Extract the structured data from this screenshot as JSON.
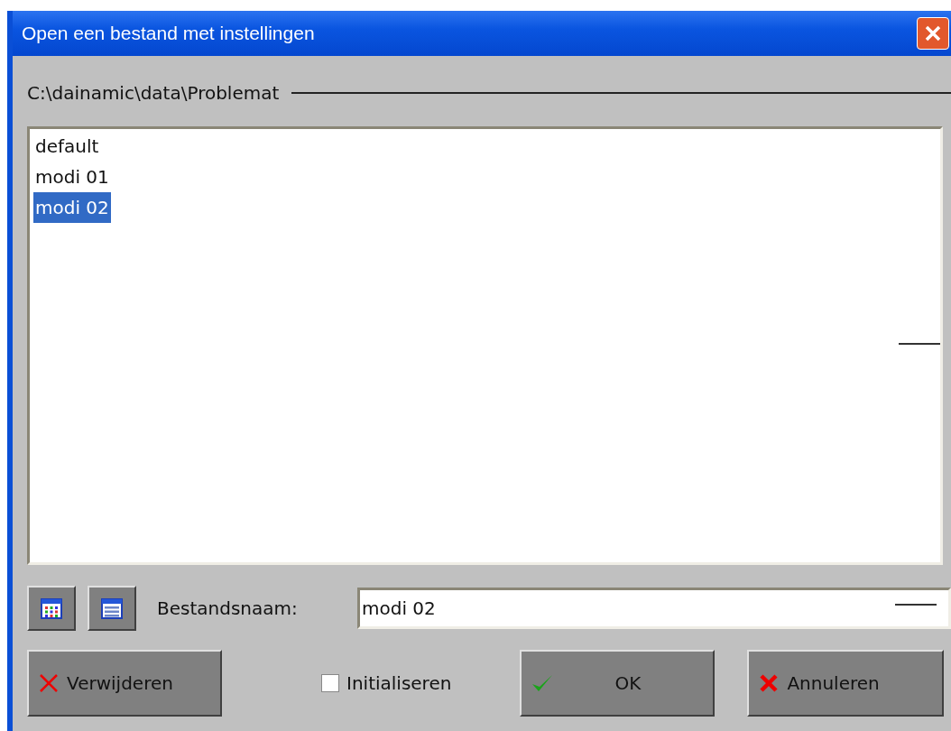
{
  "window": {
    "title": "Open een bestand met instellingen"
  },
  "path": "C:\\dainamic\\data\\Problemat",
  "files": [
    {
      "name": "default",
      "selected": false
    },
    {
      "name": "modi 01",
      "selected": false
    },
    {
      "name": "modi 02",
      "selected": true
    }
  ],
  "filename": {
    "label": "Bestandsnaam:",
    "value": "modi 02"
  },
  "initialize": {
    "label": "Initialiseren",
    "checked": false
  },
  "buttons": [
    {
      "kind": "delete",
      "label": "Verwijderen"
    },
    {
      "kind": "ok",
      "label": "OK"
    },
    {
      "kind": "cancel",
      "label": "Annuleren"
    }
  ]
}
